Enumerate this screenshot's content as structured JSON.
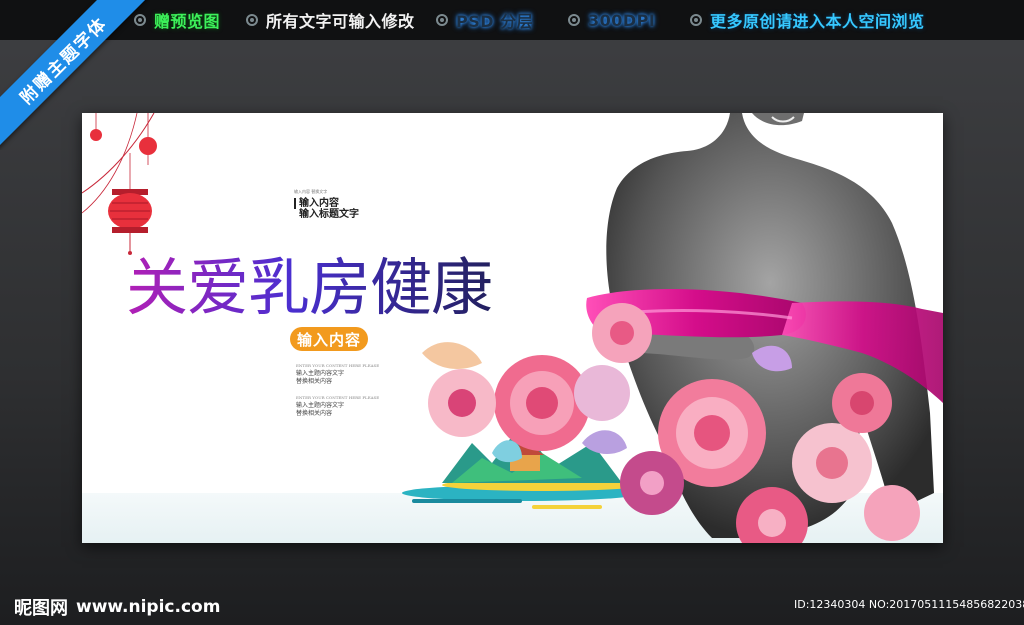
{
  "top_bar": {
    "items": [
      {
        "label": "赠预览图",
        "color": "#3df05a"
      },
      {
        "label": "所有文字可输入修改",
        "color": "#f2f2f2"
      },
      {
        "label": "PSD 分层",
        "color": "#3a9cff"
      },
      {
        "label": "300DPI",
        "color": "#3a9cff"
      },
      {
        "label": "更多原创请进入本人空间浏览",
        "color": "#36c8ff"
      }
    ]
  },
  "ribbon": {
    "label": "附赠主题字体",
    "color": "#1f8de8"
  },
  "poster": {
    "headline": "关爱乳房健康",
    "badge": "输入内容",
    "top_block": {
      "tiny": "输入内容 替换文字",
      "line1": "输入内容",
      "line2": "输入标题文字"
    },
    "para1": {
      "tiny": "ENTER YOUR CONTENT HERE PLEASE",
      "line1": "输入主题内容文字",
      "line2": "替换相关内容"
    },
    "para2": {
      "tiny": "ENTER YOUR CONTENT HERE PLEASE",
      "line1": "输入主题内容文字",
      "line2": "替换相关内容"
    }
  },
  "footer": {
    "logo_cn": "昵图网",
    "logo_url": "www.nipic.com",
    "id_text": "ID:12340304 NO:20170511154856822038"
  }
}
